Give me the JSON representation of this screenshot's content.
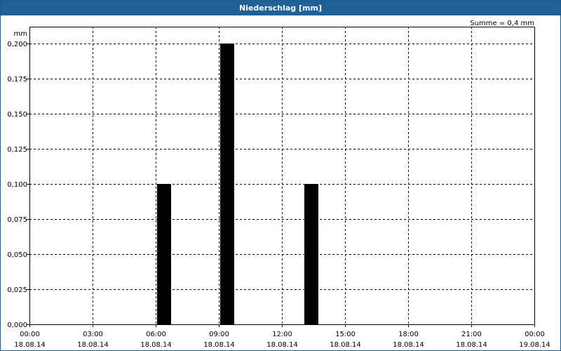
{
  "window": {
    "title": "Niederschlag [mm]"
  },
  "summary": {
    "text": "Summe = 0,4 mm"
  },
  "colors": {
    "titlebar": "#1f6196",
    "bar": "#000000",
    "grid": "#000000"
  },
  "chart_data": {
    "type": "bar",
    "title": "Niederschlag [mm]",
    "ylabel": "mm",
    "xlabel": "",
    "ylim": [
      0,
      0.2
    ],
    "grid": true,
    "y_ticks": [
      {
        "value": 0,
        "label": "0,000"
      },
      {
        "value": 0.025,
        "label": "0,025"
      },
      {
        "value": 0.05,
        "label": "0,050"
      },
      {
        "value": 0.075,
        "label": "0,075"
      },
      {
        "value": 0.1,
        "label": "0,100"
      },
      {
        "value": 0.125,
        "label": "0,125"
      },
      {
        "value": 0.15,
        "label": "0,150"
      },
      {
        "value": 0.175,
        "label": "0,175"
      },
      {
        "value": 0.2,
        "label": "0,200"
      }
    ],
    "x_range": [
      "2014-08-18T00:00",
      "2014-08-19T00:00"
    ],
    "x_ticks": [
      {
        "time": "2014-08-18T00:00",
        "label_time": "00:00",
        "label_date": "18.08.14"
      },
      {
        "time": "2014-08-18T03:00",
        "label_time": "03:00",
        "label_date": "18.08.14"
      },
      {
        "time": "2014-08-18T06:00",
        "label_time": "06:00",
        "label_date": "18.08.14"
      },
      {
        "time": "2014-08-18T09:00",
        "label_time": "09:00",
        "label_date": "18.08.14"
      },
      {
        "time": "2014-08-18T12:00",
        "label_time": "12:00",
        "label_date": "18.08.14"
      },
      {
        "time": "2014-08-18T15:00",
        "label_time": "15:00",
        "label_date": "18.08.14"
      },
      {
        "time": "2014-08-18T18:00",
        "label_time": "18:00",
        "label_date": "18.08.14"
      },
      {
        "time": "2014-08-18T21:00",
        "label_time": "21:00",
        "label_date": "18.08.14"
      },
      {
        "time": "2014-08-19T00:00",
        "label_time": "00:00",
        "label_date": "19.08.14"
      }
    ],
    "bars": [
      {
        "start": "2014-08-18T06:00",
        "end": "2014-08-18T07:00",
        "value": 0.1
      },
      {
        "start": "2014-08-18T09:00",
        "end": "2014-08-18T10:00",
        "value": 0.2
      },
      {
        "start": "2014-08-18T13:00",
        "end": "2014-08-18T14:00",
        "value": 0.1
      }
    ]
  }
}
